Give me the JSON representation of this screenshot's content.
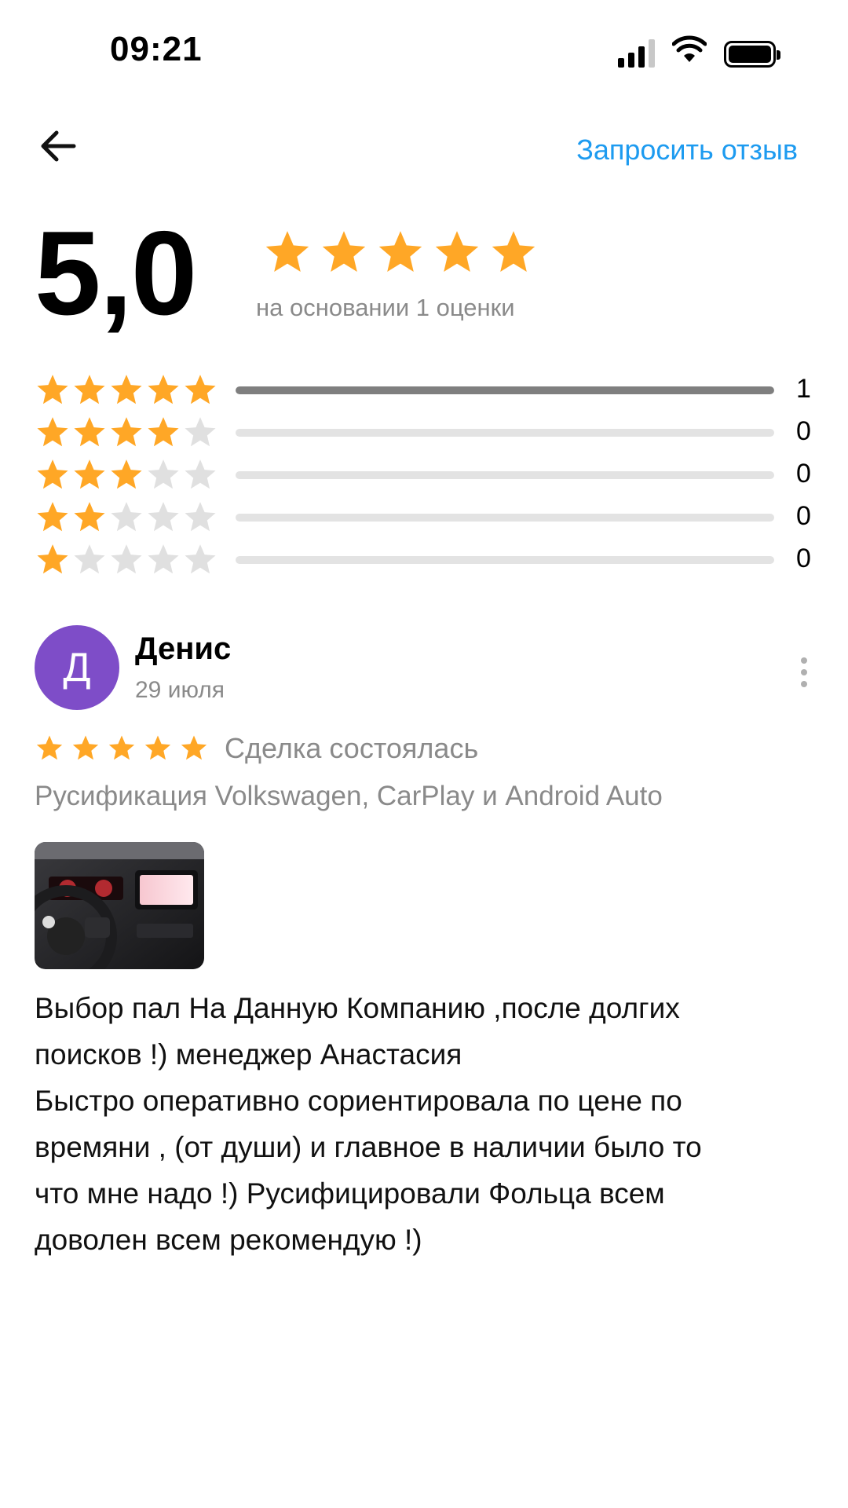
{
  "status_bar": {
    "time": "09:21",
    "signal_icon": "signal-icon",
    "wifi_icon": "wifi-icon",
    "battery_icon": "battery-icon"
  },
  "header": {
    "back_icon": "arrow-left-icon",
    "request_review_label": "Запросить отзыв",
    "link_color": "#1d9bf0"
  },
  "summary": {
    "score": "5,0",
    "stars": 5,
    "basis": "на основании 1 оценки",
    "star_color": "#ffa726"
  },
  "distribution": [
    {
      "stars": 5,
      "count": "1",
      "fill": 1.0
    },
    {
      "stars": 4,
      "count": "0",
      "fill": 0
    },
    {
      "stars": 3,
      "count": "0",
      "fill": 0
    },
    {
      "stars": 2,
      "count": "0",
      "fill": 0
    },
    {
      "stars": 1,
      "count": "0",
      "fill": 0
    }
  ],
  "review": {
    "avatar_letter": "Д",
    "avatar_color": "#7e4dc8",
    "author": "Денис",
    "date": "29 июля",
    "stars": 5,
    "deal_status": "Сделка состоялась",
    "product": "Русификация Volkswagen, CarPlay и Android Auto",
    "more_icon": "more-vertical-icon",
    "text_lines": [
      "Выбор пал На Данную Компанию ,после долгих",
      "поисков !) менеджер Анастасия",
      "Быстро оперативно сориентировала по цене по",
      "времяни , (от души) и главное в наличии было то",
      "что мне надо !) Русифицировали Фольца всем",
      "доволен всем рекомендую !)"
    ]
  }
}
